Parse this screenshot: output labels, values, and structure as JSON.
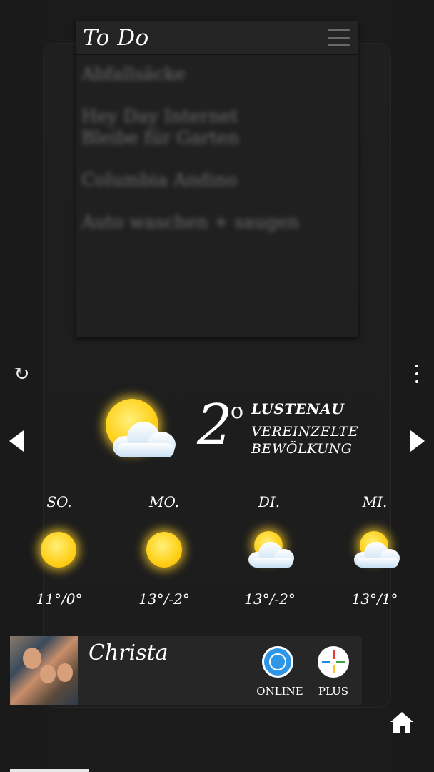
{
  "todo": {
    "title": "To Do",
    "items": [
      "Abfallsäcke",
      "Hey Day Internet\nBleibe für Garten",
      "Columbia Andino",
      "Auto waschen + saugen"
    ]
  },
  "controls": {
    "refresh_glyph": "↻"
  },
  "weather": {
    "current": {
      "temp": "2",
      "deg_symbol": "o",
      "city": "LUSTENAU",
      "condition": "VEREINZELTE\nBEWÖLKUNG",
      "icon": "partly-cloudy-icon"
    },
    "forecast": [
      {
        "day": "SO.",
        "range": "11°/0°",
        "icon": "sun-icon"
      },
      {
        "day": "MO.",
        "range": "13°/-2°",
        "icon": "sun-icon"
      },
      {
        "day": "DI.",
        "range": "13°/-2°",
        "icon": "partly-cloudy-icon"
      },
      {
        "day": "MI.",
        "range": "13°/1°",
        "icon": "partly-cloudy-icon"
      }
    ]
  },
  "contact": {
    "name": "Christa",
    "whatsapp_label": "ONLINE",
    "plus_label": "PLUS"
  },
  "colors": {
    "background": "#1b1b1b",
    "sun": "#ffd21e",
    "whatsapp": "#2d96e6"
  }
}
